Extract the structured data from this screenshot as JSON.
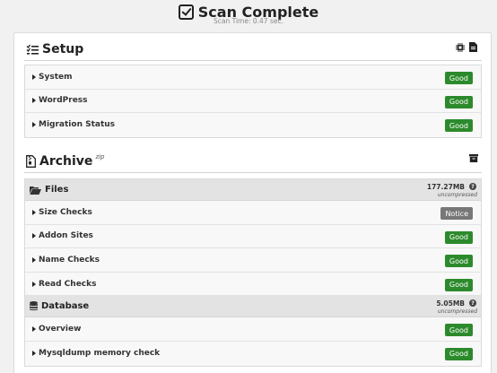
{
  "header": {
    "title": "Scan Complete",
    "scan_time": "Scan Time: 0.47 sec."
  },
  "setup": {
    "title": "Setup",
    "rows": [
      {
        "label": "System",
        "status": "Good"
      },
      {
        "label": "WordPress",
        "status": "Good"
      },
      {
        "label": "Migration Status",
        "status": "Good"
      }
    ]
  },
  "archive": {
    "title": "Archive",
    "format": "zip",
    "files": {
      "title": "Files",
      "size": "177.27MB",
      "size_note": "uncompressed",
      "rows": [
        {
          "label": "Size Checks",
          "status": "Notice"
        },
        {
          "label": "Addon Sites",
          "status": "Good"
        },
        {
          "label": "Name Checks",
          "status": "Good"
        },
        {
          "label": "Read Checks",
          "status": "Good"
        }
      ]
    },
    "database": {
      "title": "Database",
      "size": "5.05MB",
      "size_note": "uncompressed",
      "rows": [
        {
          "label": "Overview",
          "status": "Good"
        },
        {
          "label": "Mysqldump memory check",
          "status": "Good"
        }
      ]
    }
  },
  "help_glyph": "?",
  "colors": {
    "good": "#2c8a2c",
    "notice": "#777777"
  }
}
